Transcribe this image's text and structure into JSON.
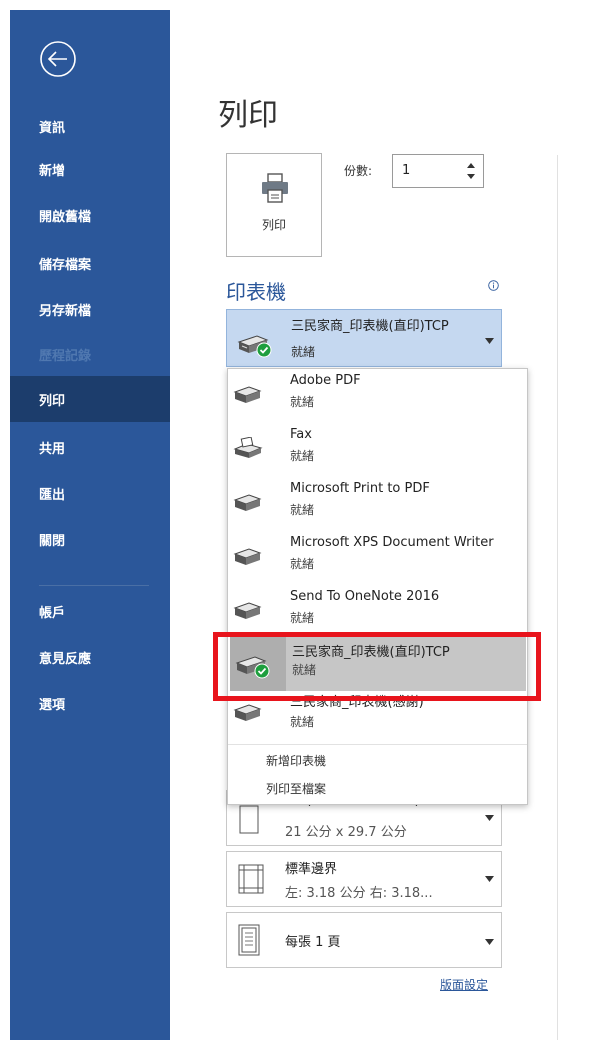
{
  "sidebar": {
    "items": [
      {
        "label": "資訊"
      },
      {
        "label": "新增"
      },
      {
        "label": "開啟舊檔"
      },
      {
        "label": "儲存檔案"
      },
      {
        "label": "另存新檔"
      },
      {
        "label": "歷程記錄"
      },
      {
        "label": "列印"
      },
      {
        "label": "共用"
      },
      {
        "label": "匯出"
      },
      {
        "label": "關閉"
      },
      {
        "label": "帳戶"
      },
      {
        "label": "意見反應"
      },
      {
        "label": "選項"
      }
    ],
    "active_label": "列印",
    "disabled_label": "歷程記錄"
  },
  "main": {
    "title": "列印",
    "print_button_label": "列印",
    "copies_label": "份數:",
    "copies_value": "1"
  },
  "printer": {
    "heading": "印表機",
    "selected_name": "三民家商_印表機(直印)TCP",
    "selected_status": "就緒"
  },
  "dropdown": {
    "items": [
      {
        "name": "Adobe PDF",
        "status": "就緒",
        "icon": "printer-icon"
      },
      {
        "name": "Fax",
        "status": "就緒",
        "icon": "fax-icon"
      },
      {
        "name": "Microsoft Print to PDF",
        "status": "就緒",
        "icon": "printer-icon"
      },
      {
        "name": "Microsoft XPS Document Writer",
        "status": "就緒",
        "icon": "printer-icon"
      },
      {
        "name": "Send To OneNote 2016",
        "status": "就緒",
        "icon": "printer-icon"
      },
      {
        "name": "三民家商_印表機(直印)TCP",
        "status": "就緒",
        "icon": "default-printer-check-icon",
        "selected": true
      },
      {
        "name": "三民家商_印表機(感謝)",
        "status": "就緒",
        "icon": "printer-icon"
      }
    ],
    "add_printer": "新增印表機",
    "print_to_file": "列印至檔案"
  },
  "settings": {
    "paper_size_partial": "A4 (21.0 x 29.7 mm)",
    "paper_dimensions": "21 公分 x 29.7 公分",
    "margins_name": "標準邊界",
    "margins_detail": "左: 3.18 公分   右: 3.18...",
    "pages_per_sheet": "每張 1 頁",
    "page_setup_link": "版面設定"
  },
  "colors": {
    "sidebar": "#2b579a",
    "sidebar_active": "#1c3d6c",
    "highlight_frame": "#e8141c",
    "selected_printer_bg": "#c5d8f0"
  }
}
